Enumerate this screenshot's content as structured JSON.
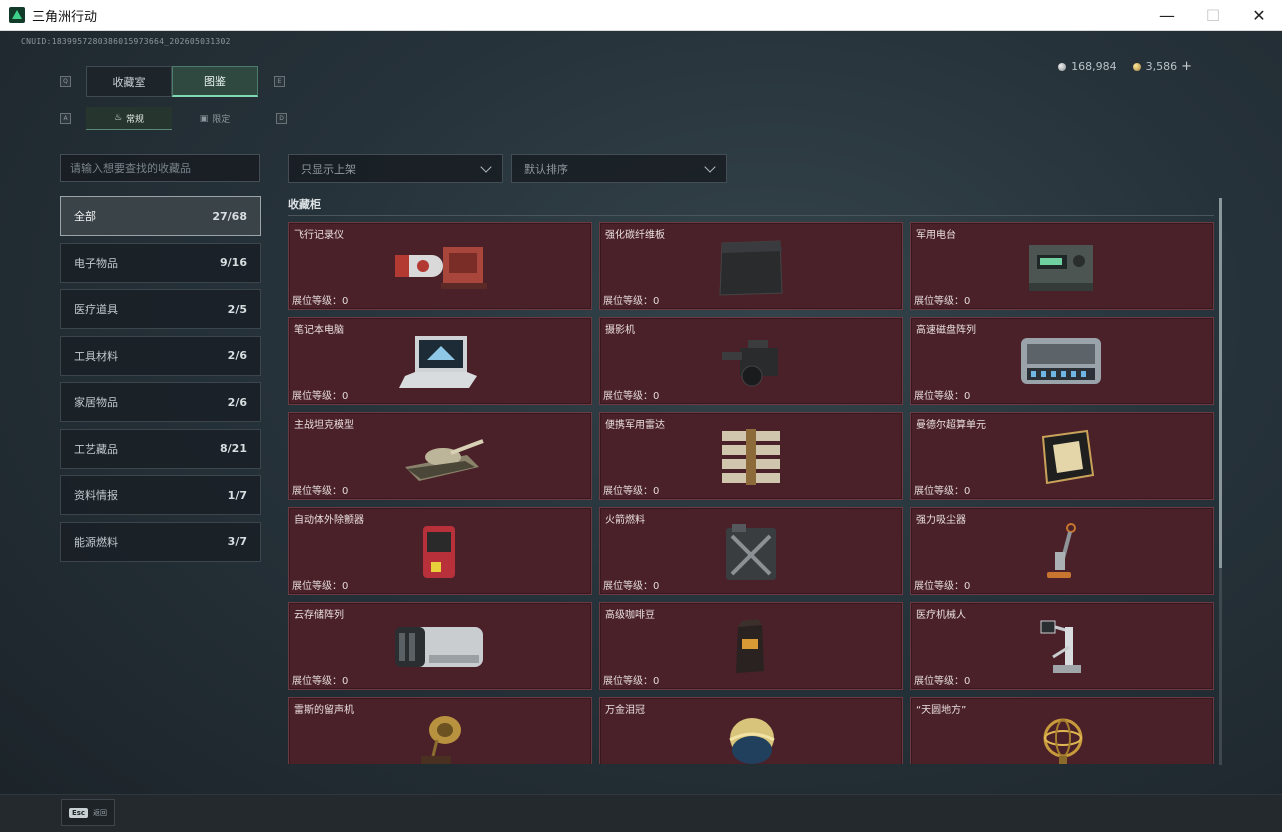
{
  "window": {
    "title": "三角洲行动",
    "minimize": "—",
    "maximize": "☐",
    "close": "✕",
    "logo_icon": "delta-logo-icon"
  },
  "header": {
    "uid": "CNUID:1839957280386015973664_202605031302",
    "currency": [
      {
        "icon": "silver-coin-icon",
        "value": "168,984"
      },
      {
        "icon": "gold-coin-icon",
        "value": "3,586"
      }
    ],
    "add_label": "+"
  },
  "keys": {
    "tab_left": "Q",
    "tab_right": "E",
    "sub_left": "A",
    "sub_right": "D"
  },
  "tabs": [
    {
      "label": "收藏室",
      "active": false
    },
    {
      "label": "图鉴",
      "active": true
    }
  ],
  "subtabs": [
    {
      "label": "常规",
      "icon": "flame-icon",
      "active": true
    },
    {
      "label": "限定",
      "icon": "box-icon",
      "active": false
    }
  ],
  "search": {
    "placeholder": "请输入想要查找的收藏品"
  },
  "filters": {
    "availability": "只显示上架",
    "sort": "默认排序"
  },
  "categories": [
    {
      "label": "全部",
      "count": "27/68",
      "active": true
    },
    {
      "label": "电子物品",
      "count": "9/16",
      "active": false
    },
    {
      "label": "医疗道具",
      "count": "2/5",
      "active": false
    },
    {
      "label": "工具材料",
      "count": "2/6",
      "active": false
    },
    {
      "label": "家居物品",
      "count": "2/6",
      "active": false
    },
    {
      "label": "工艺藏品",
      "count": "8/21",
      "active": false
    },
    {
      "label": "资料情报",
      "count": "1/7",
      "active": false
    },
    {
      "label": "能源燃料",
      "count": "3/7",
      "active": false
    }
  ],
  "section": {
    "title": "收藏柜"
  },
  "level_prefix": "展位等级：",
  "items": [
    {
      "name": "飞行记录仪",
      "level": "0",
      "icon": "flight-recorder-icon"
    },
    {
      "name": "强化碳纤维板",
      "level": "0",
      "icon": "carbon-plate-icon"
    },
    {
      "name": "军用电台",
      "level": "0",
      "icon": "military-radio-icon"
    },
    {
      "name": "笔记本电脑",
      "level": "0",
      "icon": "laptop-icon"
    },
    {
      "name": "摄影机",
      "level": "0",
      "icon": "camera-icon"
    },
    {
      "name": "高速磁盘阵列",
      "level": "0",
      "icon": "disk-array-icon"
    },
    {
      "name": "主战坦克模型",
      "level": "0",
      "icon": "tank-model-icon"
    },
    {
      "name": "便携军用雷达",
      "level": "0",
      "icon": "portable-radar-icon"
    },
    {
      "name": "曼德尔超算单元",
      "level": "0",
      "icon": "supercompute-unit-icon"
    },
    {
      "name": "自动体外除颤器",
      "level": "0",
      "icon": "defibrillator-icon"
    },
    {
      "name": "火箭燃料",
      "level": "0",
      "icon": "rocket-fuel-icon"
    },
    {
      "name": "强力吸尘器",
      "level": "0",
      "icon": "vacuum-cleaner-icon"
    },
    {
      "name": "云存储阵列",
      "level": "0",
      "icon": "cloud-storage-icon"
    },
    {
      "name": "高级咖啡豆",
      "level": "0",
      "icon": "coffee-beans-icon"
    },
    {
      "name": "医疗机械人",
      "level": "0",
      "icon": "medical-robot-icon"
    },
    {
      "name": "雷斯的留声机",
      "level": "",
      "icon": "gramophone-icon"
    },
    {
      "name": "万金泪冠",
      "level": "",
      "icon": "jeweled-egg-icon"
    },
    {
      "name": "“天圆地方”",
      "level": "",
      "icon": "armillary-sphere-icon"
    }
  ],
  "footer": {
    "esc_key": "Esc",
    "esc_label": "返回"
  },
  "colors": {
    "card_bg": "#4a2128",
    "accent": "#7fd9b3"
  }
}
